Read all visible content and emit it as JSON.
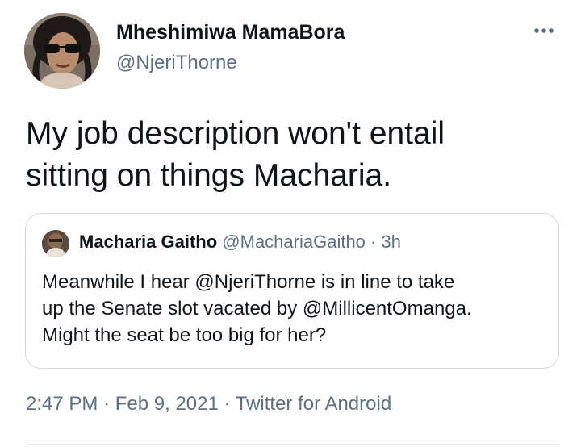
{
  "author": {
    "display_name": "Mheshimiwa MamaBora",
    "handle": "@NjeriThorne"
  },
  "menu": {
    "icon": "more-horizontal-icon"
  },
  "tweet": {
    "text_line1": "My job description won't entail",
    "text_line2": "sitting on things Macharia."
  },
  "quoted_tweet": {
    "display_name": "Macharia Gaitho",
    "handle": "@MachariaGaitho",
    "separator": "·",
    "time": "3h",
    "text_line1": "Meanwhile I hear @NjeriThorne is in line to take",
    "text_line2": "up the Senate slot vacated by @MillicentOmanga.",
    "text_line3": "Might the seat be too big for her?"
  },
  "meta": {
    "time": "2:47 PM",
    "separator1": "·",
    "date": "Feb 9, 2021",
    "separator2": "·",
    "source": "Twitter for Android"
  },
  "colors": {
    "text": "#0f1419",
    "secondary": "#5b7083",
    "border": "#cfd9de"
  }
}
